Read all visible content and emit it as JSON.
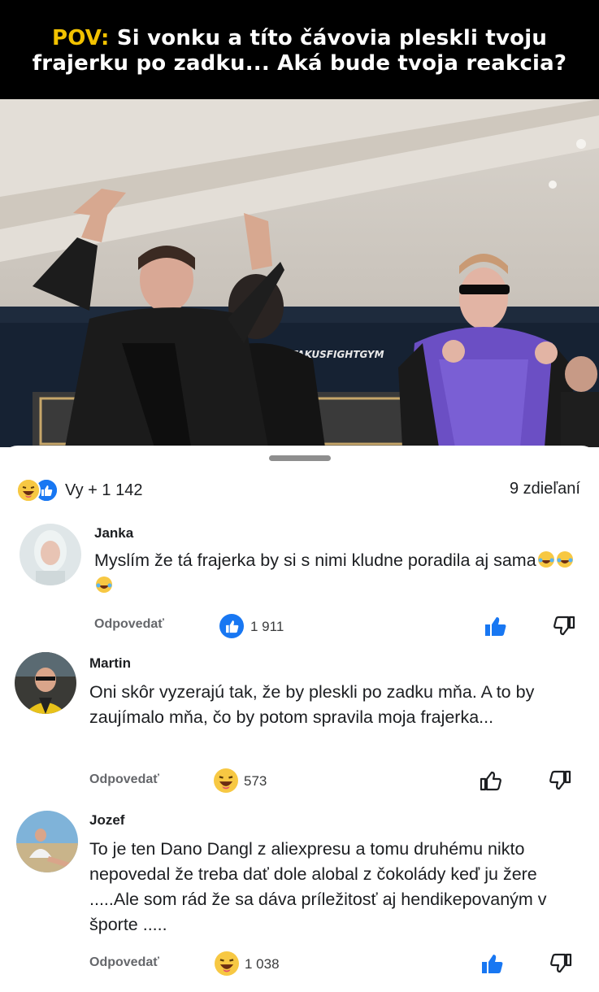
{
  "header": {
    "pov": "POV:",
    "line1_rest": " Si vonku a títo čávovia pleskli tvoju",
    "line2": "frajerku po zadku... Aká bude tvoja reakcia?"
  },
  "photo": {
    "banner_text": "ARTAKUSFIGHTGYM"
  },
  "post": {
    "reactions_text": "Vy + 1 142",
    "shares_text": "9 zdieľaní"
  },
  "comments": [
    {
      "name": "Janka",
      "text": "Myslím že tá frajerka by si s nimi kludne poradila aj sama",
      "reply": "Odpovedať",
      "reaction": "like",
      "count": "1 911",
      "liked": true
    },
    {
      "name": "Martin",
      "text": "Oni skôr vyzerajú tak,  že by pleskli po zadku mňa. A to by zaujímalo mňa,  čo by potom spravila moja frajerka...",
      "reply": "Odpovedať",
      "reaction": "haha",
      "count": "573",
      "liked": false
    },
    {
      "name": "Jozef",
      "text": "To je ten Dano Dangl z aliexpresu a tomu druhému nikto nepovedal že treba dať dole alobal z čokolády keď ju žere .....Ale som rád že  sa dáva príležitosť aj hendikepovaným v športe .....",
      "reply": "Odpovedať",
      "reaction": "haha",
      "count": "1 038",
      "liked": true
    }
  ],
  "colors": {
    "accent": "#1877f2",
    "pov": "#f2c200",
    "haha": "#f7c843"
  }
}
